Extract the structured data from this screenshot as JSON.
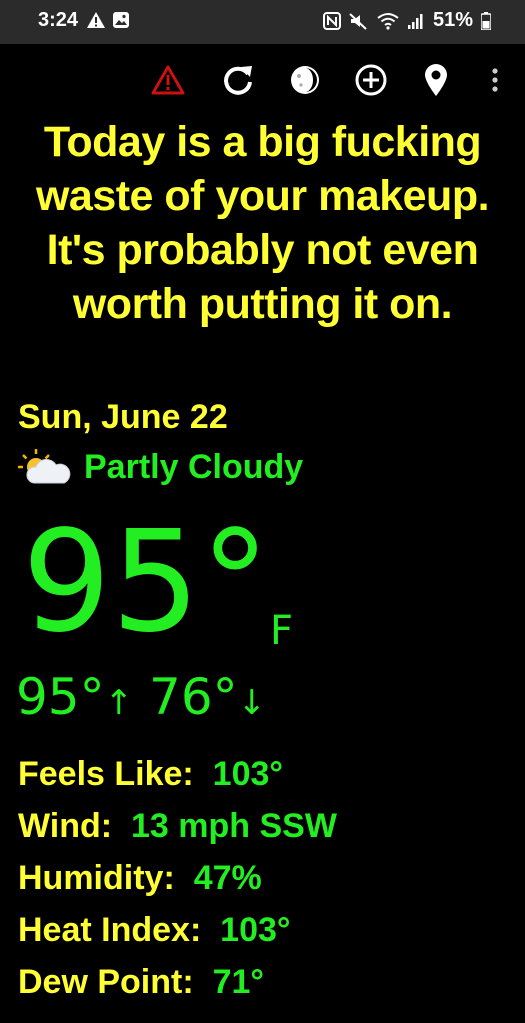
{
  "status_bar": {
    "time": "3:24",
    "battery": "51%"
  },
  "toolbar": {
    "icons": [
      "warning-icon",
      "refresh-icon",
      "moon-phase-icon",
      "add-icon",
      "location-pin-icon",
      "more-vert-icon"
    ]
  },
  "quote": "Today is a big fucking waste of your makeup. It's probably not even worth putting it on.",
  "weather": {
    "date": "Sun, June 22",
    "condition": "Partly Cloudy",
    "condition_icon": "partly-cloudy-icon",
    "temperature": "95°",
    "unit": "F",
    "high": "95°",
    "low": "76°",
    "high_arrow": "↑",
    "low_arrow": "↓"
  },
  "details": [
    {
      "label": "Feels Like:",
      "value": "103°"
    },
    {
      "label": "Wind:",
      "value": "13 mph SSW"
    },
    {
      "label": "Humidity:",
      "value": "47%"
    },
    {
      "label": "Heat Index:",
      "value": "103°"
    },
    {
      "label": "Dew Point:",
      "value": "71°"
    }
  ],
  "colors": {
    "accent_yellow": "#ffff33",
    "accent_green": "#22ee22",
    "background": "#000000",
    "warning_red": "#cc1111"
  }
}
